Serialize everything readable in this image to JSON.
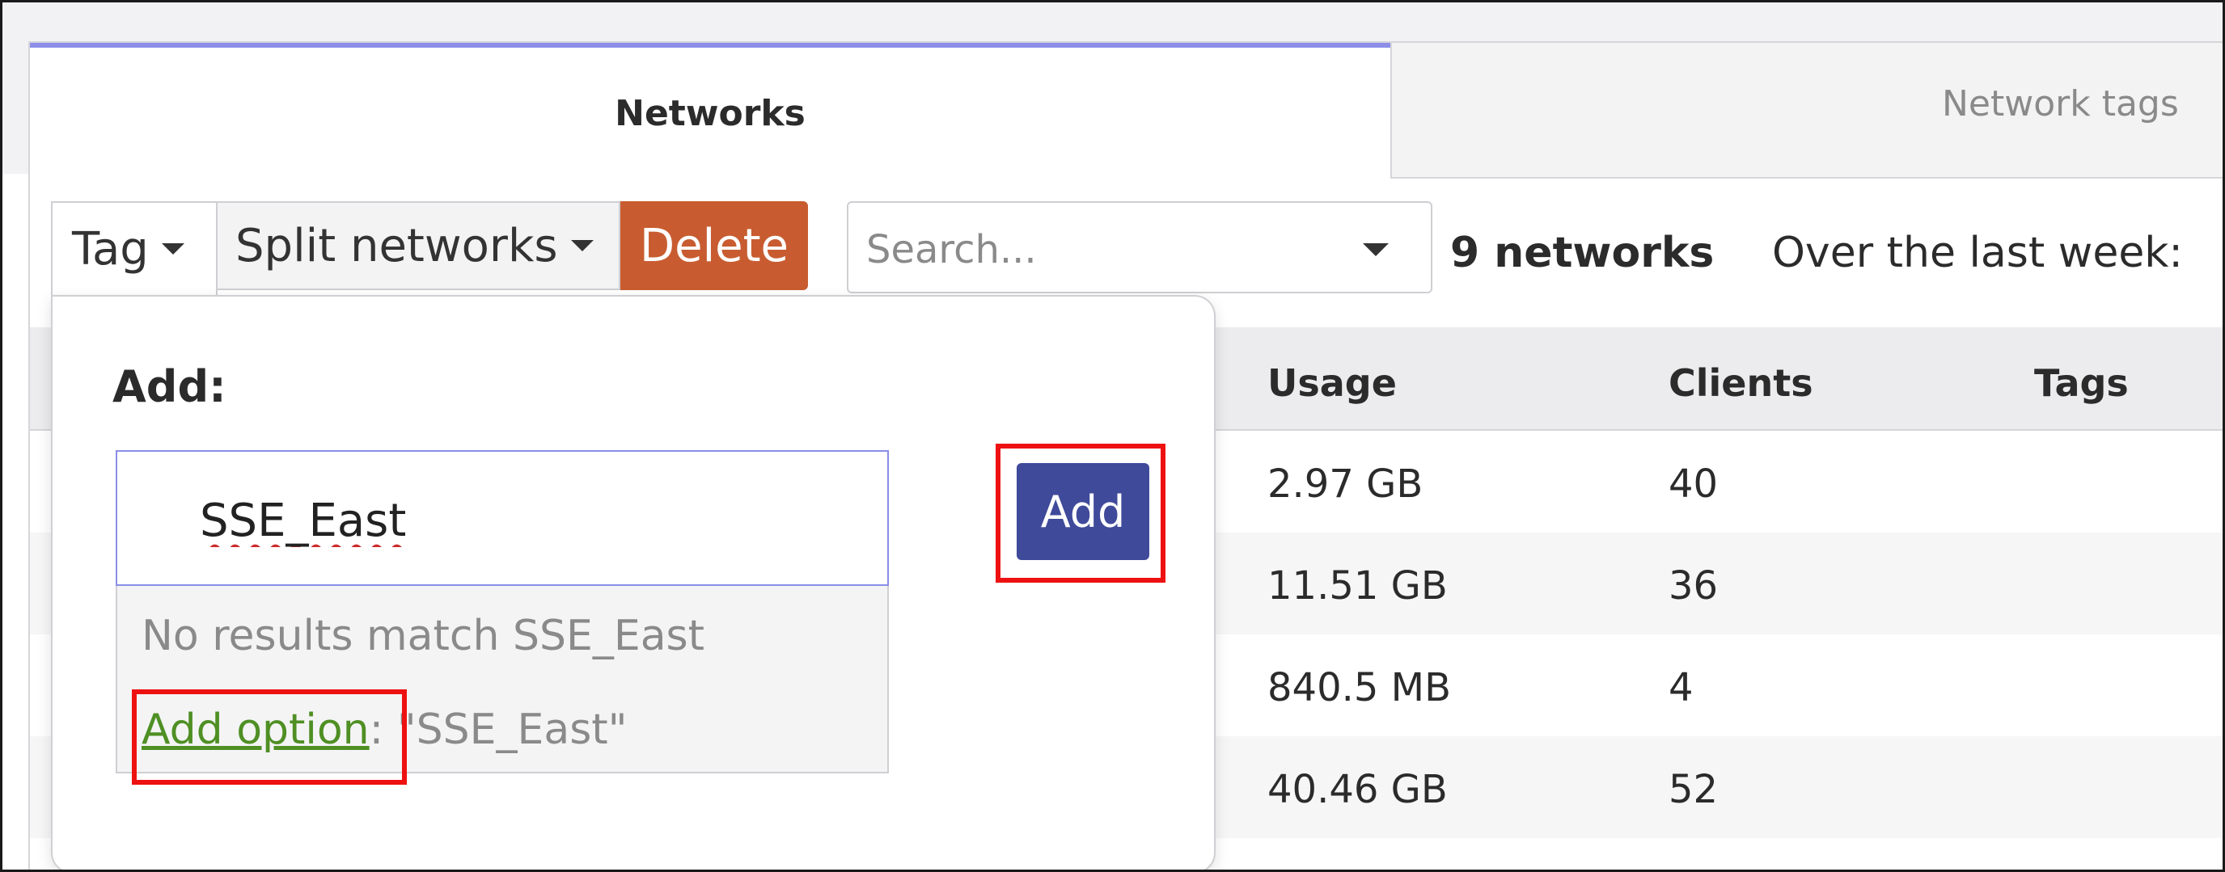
{
  "tabs": {
    "networks": "Networks",
    "network_tags": "Network tags"
  },
  "toolbar": {
    "tag_label": "Tag",
    "split_label": "Split networks",
    "delete_label": "Delete",
    "search_placeholder": "Search...",
    "network_count": "9 networks",
    "range_label": "Over the last week:"
  },
  "popover": {
    "title": "Add:",
    "input_value": "SSE_East",
    "no_results": "No results match SSE_East",
    "add_option_link": "Add option",
    "add_option_suffix": ": \"SSE_East\"",
    "add_button": "Add"
  },
  "table": {
    "headers": {
      "usage": "Usage",
      "clients": "Clients",
      "tags": "Tags"
    },
    "rows": [
      {
        "usage": "2.97 GB",
        "clients": "40",
        "tags": ""
      },
      {
        "usage": "11.51 GB",
        "clients": "36",
        "tags": ""
      },
      {
        "usage": "840.5 MB",
        "clients": "4",
        "tags": ""
      },
      {
        "usage": "40.46 GB",
        "clients": "52",
        "tags": ""
      }
    ]
  },
  "colors": {
    "delete": "#c85c30",
    "add_button": "#3f4a9a",
    "tab_accent": "#8c8ee8",
    "highlight": "#ee1111",
    "link": "#4f8f24"
  }
}
